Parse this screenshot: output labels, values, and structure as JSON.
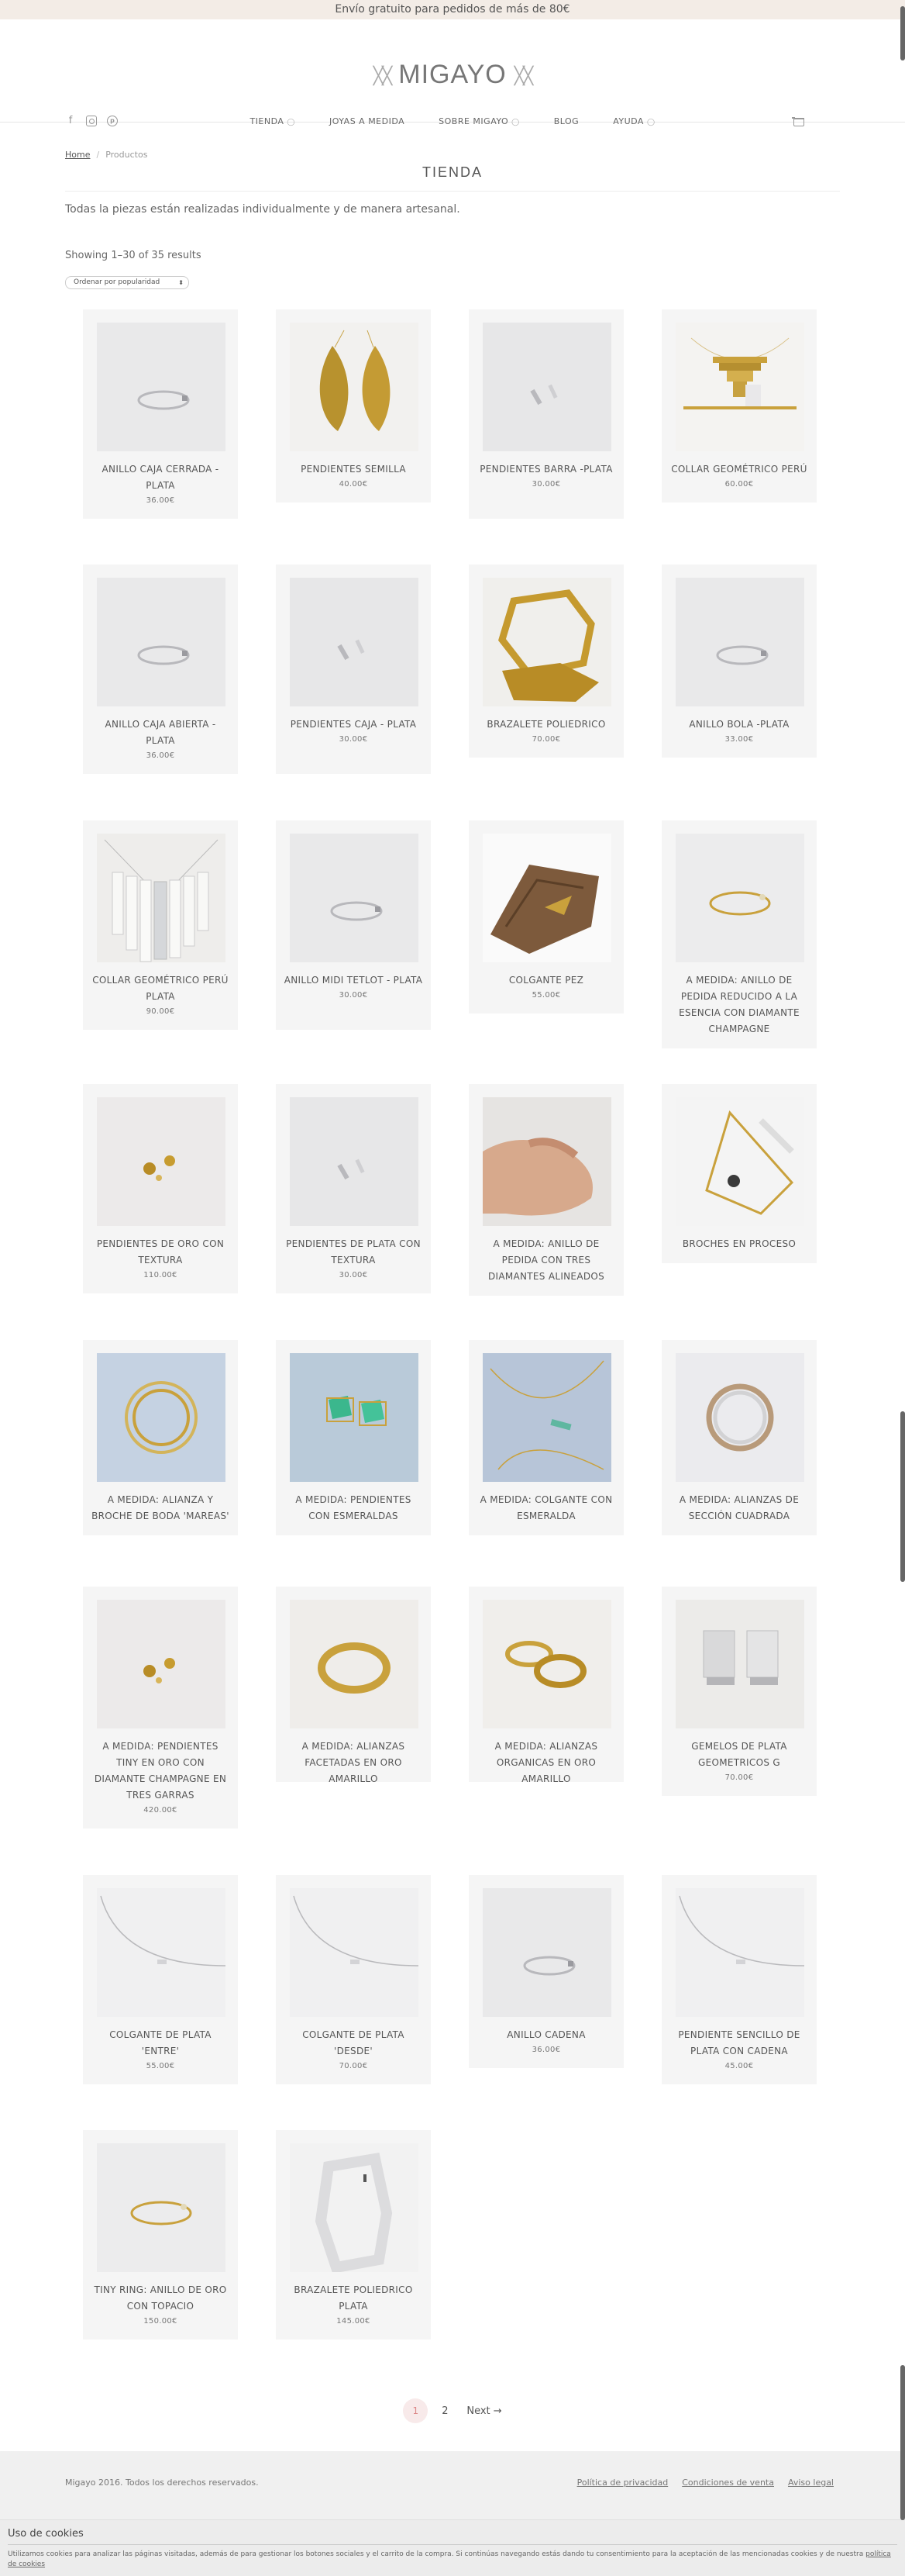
{
  "topbar": {
    "text": "Envío gratuito para pedidos de más de 80€"
  },
  "header": {
    "logo": "MIGAYO",
    "social": [
      "facebook-icon",
      "instagram-icon",
      "pinterest-icon"
    ],
    "nav": [
      {
        "label": "TIENDA",
        "dropdown": true
      },
      {
        "label": "JOYAS A MEDIDA",
        "dropdown": false
      },
      {
        "label": "SOBRE MIGAYO",
        "dropdown": true
      },
      {
        "label": "BLOG",
        "dropdown": false
      },
      {
        "label": "AYUDA",
        "dropdown": true
      }
    ]
  },
  "breadcrumb": {
    "home": "Home",
    "current": "Productos"
  },
  "page": {
    "title": "TIENDA",
    "intro": "Todas la piezas están realizadas individualmente y de manera artesanal.",
    "results": "Showing 1–30 of 35 results",
    "sort_selected": "Ordenar por popularidad"
  },
  "products": [
    {
      "name": "ANILLO CAJA CERRADA - PLATA",
      "price": "36.00€",
      "kind": "ring-silver"
    },
    {
      "name": "PENDIENTES SEMILLA",
      "price": "40.00€",
      "kind": "gold-leaves"
    },
    {
      "name": "PENDIENTES BARRA -PLATA",
      "price": "30.00€",
      "kind": "silver-studs"
    },
    {
      "name": "COLLAR GEOMÉTRICO PERÚ",
      "price": "60.00€",
      "kind": "gold-necklace"
    },
    {
      "name": "ANILLO CAJA ABIERTA - PLATA",
      "price": "36.00€",
      "kind": "ring-silver"
    },
    {
      "name": "PENDIENTES CAJA - PLATA",
      "price": "30.00€",
      "kind": "silver-studs"
    },
    {
      "name": "BRAZALETE POLIEDRICO",
      "price": "70.00€",
      "kind": "gold-bracelet"
    },
    {
      "name": "ANILLO BOLA -PLATA",
      "price": "33.00€",
      "kind": "ring-silver"
    },
    {
      "name": "COLLAR GEOMÉTRICO PERÚ PLATA",
      "price": "90.00€",
      "kind": "silver-necklace"
    },
    {
      "name": "ANILLO MIDI TETLOT - PLATA",
      "price": "30.00€",
      "kind": "ring-silver"
    },
    {
      "name": "COLGANTE PEZ",
      "price": "55.00€",
      "kind": "wood"
    },
    {
      "name": "A MEDIDA: ANILLO DE PEDIDA REDUCIDO A LA ESENCIA CON DIAMANTE CHAMPAGNE",
      "price": "",
      "kind": "ring-gold-thin"
    },
    {
      "name": "PENDIENTES DE ORO CON TEXTURA",
      "price": "110.00€",
      "kind": "gold-studs"
    },
    {
      "name": "PENDIENTES DE PLATA CON TEXTURA",
      "price": "30.00€",
      "kind": "silver-studs"
    },
    {
      "name": "A MEDIDA: ANILLO DE PEDIDA CON TRES DIAMANTES ALINEADOS",
      "price": "",
      "kind": "hand"
    },
    {
      "name": "BROCHES EN PROCESO",
      "price": "",
      "kind": "gold-frame"
    },
    {
      "name": "A MEDIDA: ALIANZA Y BROCHE DE BODA 'MAREAS'",
      "price": "",
      "kind": "rings-blue"
    },
    {
      "name": "A MEDIDA: PENDIENTES CON ESMERALDAS",
      "price": "",
      "kind": "emerald"
    },
    {
      "name": "A MEDIDA: COLGANTE CON ESMERALDA",
      "price": "",
      "kind": "chain-blue"
    },
    {
      "name": "A MEDIDA: ALIANZAS DE SECCIÓN CUADRADA",
      "price": "",
      "kind": "rings-duo"
    },
    {
      "name": "A MEDIDA: PENDIENTES TINY EN ORO CON DIAMANTE CHAMPAGNE EN TRES GARRAS",
      "price": "420.00€",
      "kind": "gold-studs"
    },
    {
      "name": "A MEDIDA: ALIANZAS FACETADAS EN ORO AMARILLO",
      "price": "",
      "kind": "ring-gold"
    },
    {
      "name": "A MEDIDA: ALIANZAS ORGANICAS EN ORO AMARILLO",
      "price": "",
      "kind": "rings-gold-two"
    },
    {
      "name": "GEMELOS DE PLATA GEOMETRICOS G",
      "price": "70.00€",
      "kind": "cufflinks"
    },
    {
      "name": "COLGANTE DE PLATA 'ENTRE'",
      "price": "55.00€",
      "kind": "silver-chain"
    },
    {
      "name": "COLGANTE DE PLATA 'DESDE'",
      "price": "70.00€",
      "kind": "silver-chain"
    },
    {
      "name": "ANILLO CADENA",
      "price": "36.00€",
      "kind": "ring-silver"
    },
    {
      "name": "PENDIENTE SENCILLO DE PLATA CON CADENA",
      "price": "45.00€",
      "kind": "silver-chain"
    },
    {
      "name": "TINY RING: ANILLO DE ORO CON TOPACIO",
      "price": "150.00€",
      "kind": "ring-gold-thin"
    },
    {
      "name": "BRAZALETE POLIEDRICO PLATA",
      "price": "145.00€",
      "kind": "silver-bracelet"
    }
  ],
  "pagination": {
    "current": "1",
    "next_page": "2",
    "next_label": "Next →"
  },
  "footer": {
    "copyright": "Migayo 2016. Todos los derechos reservados.",
    "links": [
      "Política de privacidad",
      "Condiciones de venta",
      "Aviso legal"
    ]
  },
  "cookie": {
    "title": "Uso de cookies",
    "text": "Utilizamos cookies para analizar las páginas visitadas, además de para gestionar los botones sociales y el carrito de la compra. Si continúas navegando estás dando tu consentimiento para la aceptación de las mencionadas cookies y de nuestra",
    "link": "política de cookies"
  }
}
